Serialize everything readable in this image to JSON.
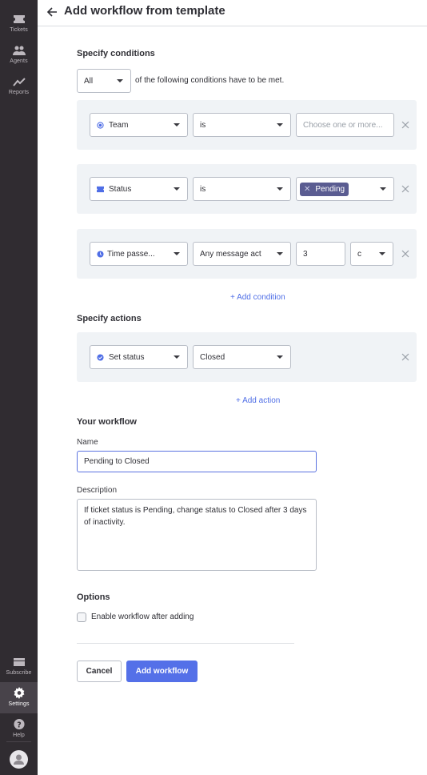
{
  "sidebar": {
    "items": [
      {
        "label": "Tickets",
        "icon": "ticket-icon"
      },
      {
        "label": "Agents",
        "icon": "agents-icon"
      },
      {
        "label": "Reports",
        "icon": "chart-line-icon"
      },
      {
        "label": "Subscribe",
        "icon": "credit-card-icon"
      },
      {
        "label": "Settings",
        "icon": "gear-icon",
        "active": true
      },
      {
        "label": "Help",
        "icon": "help-icon"
      }
    ]
  },
  "header": {
    "title": "Add workflow from template"
  },
  "conditions": {
    "title": "Specify conditions",
    "match_select": "All",
    "match_text": "of the following conditions have to be met.",
    "rows": [
      {
        "field": "Team",
        "field_icon": "team-icon",
        "operator": "is",
        "value_placeholder": "Choose one or more..."
      },
      {
        "field": "Status",
        "field_icon": "status-icon",
        "operator": "is",
        "value_tag": "Pending"
      },
      {
        "field": "Time passe...",
        "field_icon": "clock-icon",
        "operator": "Any message act",
        "value": "3",
        "unit": "c"
      }
    ],
    "add_label": "+ Add condition"
  },
  "actions": {
    "title": "Specify actions",
    "rows": [
      {
        "field": "Set status",
        "field_icon": "check-circle-icon",
        "value": "Closed"
      }
    ],
    "add_label": "+ Add action"
  },
  "workflow": {
    "title": "Your workflow",
    "name_label": "Name",
    "name_value": "Pending to Closed",
    "description_label": "Description",
    "description_value": "If ticket status is Pending, change status to Closed after 3 days of inactivity."
  },
  "options": {
    "title": "Options",
    "enable_label": "Enable workflow after adding",
    "enable_checked": false
  },
  "buttons": {
    "cancel": "Cancel",
    "submit": "Add workflow"
  },
  "colors": {
    "accent": "#5470e8",
    "tag": "#5a5c91",
    "sidebar": "#302c31"
  }
}
